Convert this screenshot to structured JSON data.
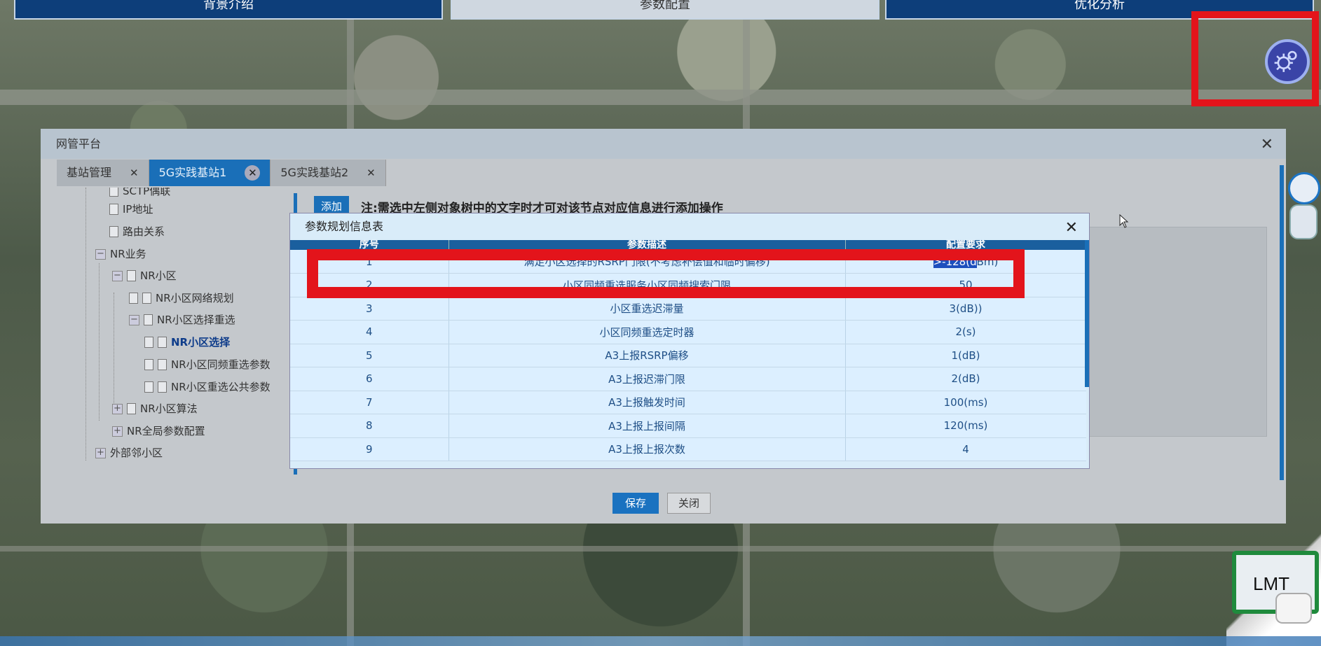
{
  "top_nav": {
    "items": [
      "背景介绍",
      "参数配置",
      "优化分析"
    ]
  },
  "dialog": {
    "title": "网管平台",
    "close_icon": "close-icon",
    "tabs": [
      {
        "label": "基站管理",
        "active": false
      },
      {
        "label": "5G实践基站1",
        "active": true
      },
      {
        "label": "5G实践基站2",
        "active": false
      }
    ],
    "tree": {
      "items": [
        {
          "label": "SCTP偶联",
          "depth": 2,
          "type": "doc"
        },
        {
          "label": "IP地址",
          "depth": 2,
          "type": "doc"
        },
        {
          "label": "路由关系",
          "depth": 2,
          "type": "doc"
        },
        {
          "label": "NR业务",
          "depth": 1,
          "type": "expanded"
        },
        {
          "label": "NR小区",
          "depth": 2,
          "type": "expanded"
        },
        {
          "label": "NR小区网络规划",
          "depth": 3,
          "type": "doc"
        },
        {
          "label": "NR小区选择重选",
          "depth": 3,
          "type": "expanded"
        },
        {
          "label": "NR小区选择",
          "depth": 4,
          "type": "doc",
          "selected": true
        },
        {
          "label": "NR小区同频重选参数",
          "depth": 4,
          "type": "doc"
        },
        {
          "label": "NR小区重选公共参数",
          "depth": 4,
          "type": "doc"
        },
        {
          "label": "NR小区算法",
          "depth": 2,
          "type": "collapsed"
        },
        {
          "label": "NR全局参数配置",
          "depth": 2,
          "type": "collapsed"
        },
        {
          "label": "外部邻小区",
          "depth": 1,
          "type": "collapsed"
        }
      ]
    },
    "add_button": "添加",
    "note": "注:需选中左侧对象树中的文字时才可对该节点对应信息进行添加操作",
    "save_button": "保存",
    "close_button": "关闭"
  },
  "popup": {
    "title": "参数规划信息表",
    "columns": [
      "序号",
      "参数描述",
      "配置要求"
    ],
    "rows": [
      {
        "no": "1",
        "desc": "满足小区选择的RSRP门限(不考虑补偿值和临时偏移)",
        "req_selected": ">-128(d",
        "req_rest": "Bm)"
      },
      {
        "no": "2",
        "desc": "小区同频重选服务小区同频搜索门限",
        "req": "50"
      },
      {
        "no": "3",
        "desc": "小区重选迟滞量",
        "req": "3(dB))"
      },
      {
        "no": "4",
        "desc": "小区同频重选定时器",
        "req": "2(s)"
      },
      {
        "no": "5",
        "desc": "A3上报RSRP偏移",
        "req": "1(dB)"
      },
      {
        "no": "6",
        "desc": "A3上报迟滞门限",
        "req": "2(dB)"
      },
      {
        "no": "7",
        "desc": "A3上报触发时间",
        "req": "100(ms)"
      },
      {
        "no": "8",
        "desc": "A3上报上报间隔",
        "req": "120(ms)"
      },
      {
        "no": "9",
        "desc": "A3上报上报次数",
        "req": "4"
      }
    ]
  },
  "overlay": {
    "lmt_label": "LMT",
    "highlight_color": "#e3141b",
    "accent_color": "#1a6fb8"
  }
}
